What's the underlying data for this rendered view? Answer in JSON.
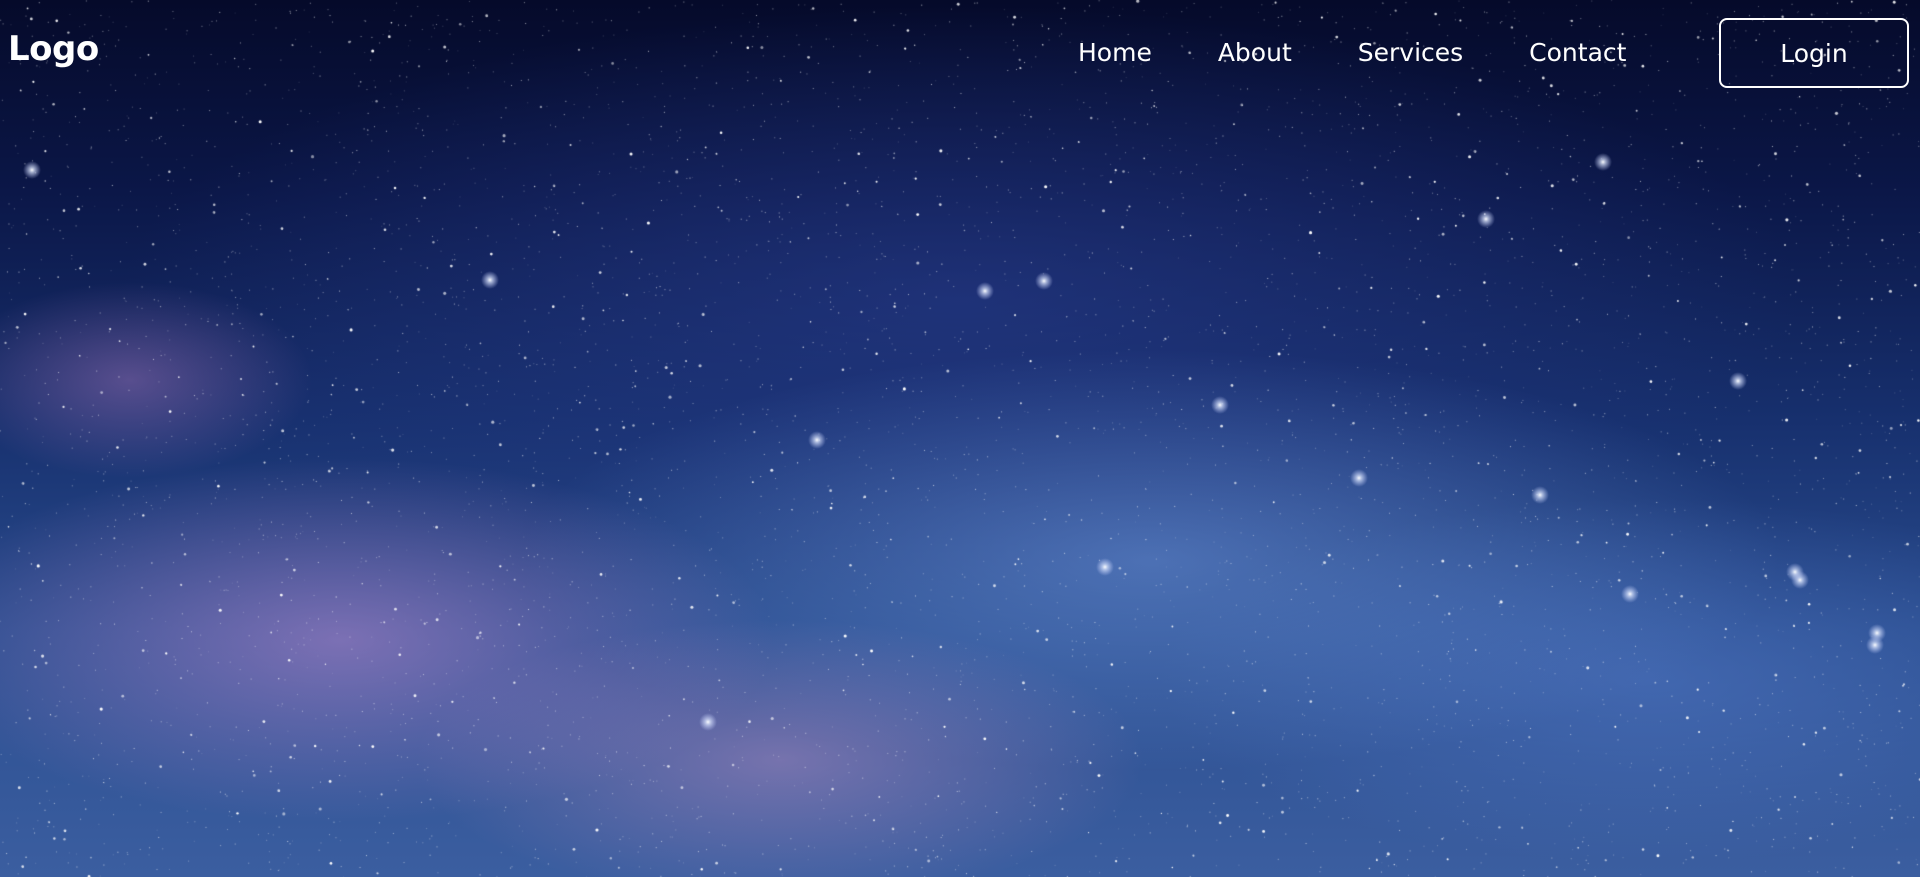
{
  "header": {
    "logo": "Logo",
    "nav": {
      "home": "Home",
      "about": "About",
      "services": "Services",
      "contact": "Contact"
    },
    "login_label": "Login"
  },
  "hero": {
    "background": "starry-night-sky-milky-way-photo"
  },
  "colors": {
    "text": "#ffffff",
    "sky_top": "#050a2a",
    "sky_bottom": "#3b5ea0"
  }
}
